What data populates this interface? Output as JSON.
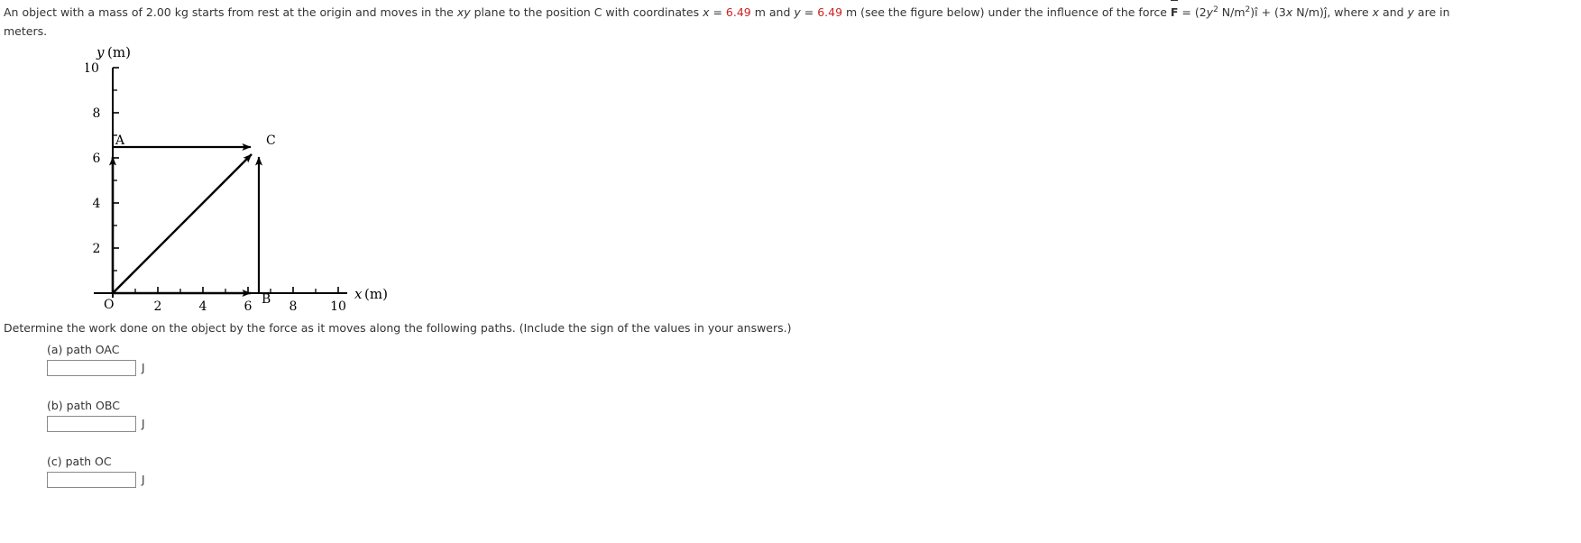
{
  "problem": {
    "text_part1": "An object with a mass of 2.00 kg starts from rest at the origin and moves in the ",
    "xy_italic": "xy",
    "text_part2": " plane to the position C with coordinates ",
    "x_symbol": "x",
    "eq1": " = ",
    "x_value": "6.49",
    "unit_m_1": " m and ",
    "y_symbol": "y",
    "eq2": " = ",
    "y_value": "6.49",
    "text_part3": " m (see the figure below) under the influence of the force ",
    "force_F": "F",
    "force_eq": " = (2",
    "force_y": "y",
    "force_exp1": "2",
    "force_units1": " N/m",
    "force_exp2": "2",
    "force_ihat": ")î + (3",
    "force_x": "x",
    "force_units2": " N/m)ĵ,",
    "text_part4": " where ",
    "where_x": "x",
    "text_part5": " and ",
    "where_y": "y",
    "text_part6": " are in",
    "text_line2": "meters."
  },
  "figure": {
    "y_axis_title": "y (m)",
    "x_axis_title": "x (m)",
    "origin_label": "O",
    "point_a_label": "A",
    "point_b_label": "B",
    "point_c_label": "C",
    "y_ticks": [
      "10",
      "8",
      "6",
      "4",
      "2"
    ],
    "x_ticks": [
      "2",
      "4",
      "6",
      "8",
      "10"
    ],
    "axis_color": "#000000",
    "point_c_x": 6.49,
    "point_c_y": 6.49,
    "axis_max": 10
  },
  "question": {
    "prompt": "Determine the work done on the object by the force as it moves along the following paths. (Include the sign of the values in your answers.)"
  },
  "answers": [
    {
      "label": "(a) path OAC",
      "value": "",
      "unit": "J"
    },
    {
      "label": "(b) path OBC",
      "value": "",
      "unit": "J"
    },
    {
      "label": "(c) path OC",
      "value": "",
      "unit": "J"
    }
  ]
}
